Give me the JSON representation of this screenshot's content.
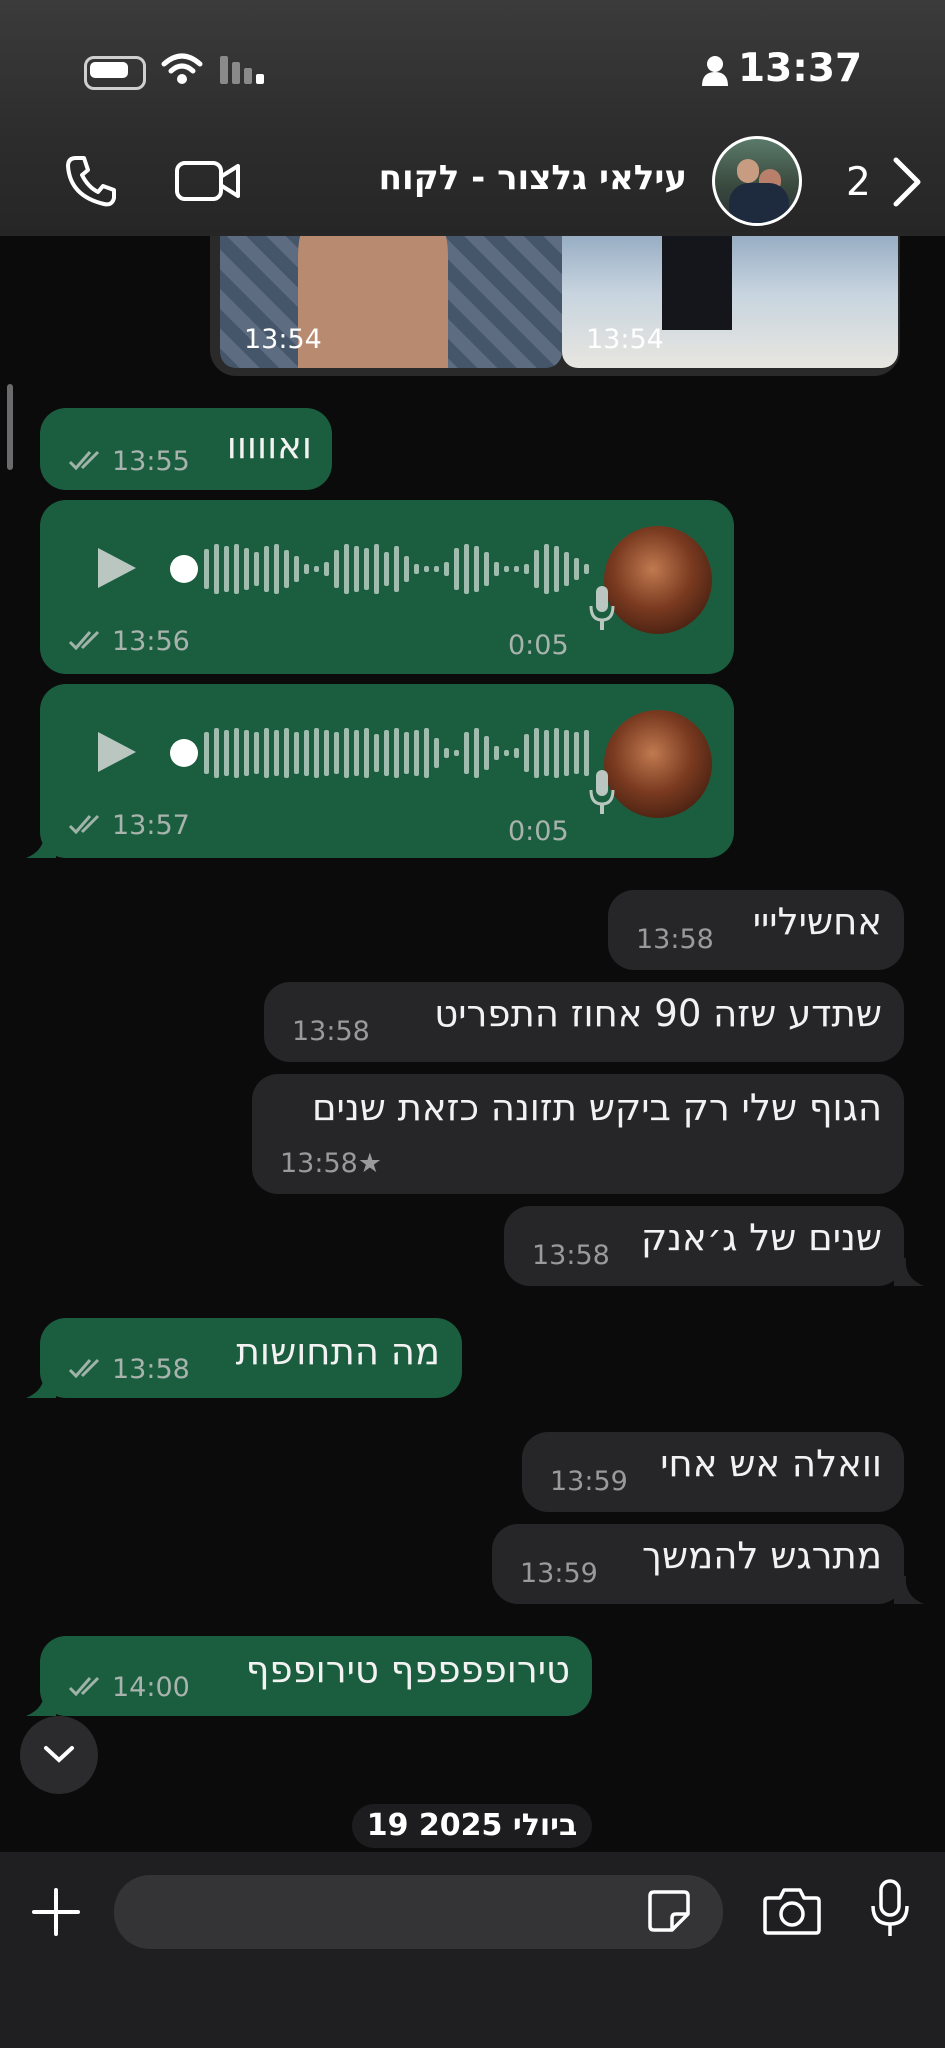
{
  "status_bar": {
    "time": "13:37"
  },
  "header": {
    "contact_name": "עילאי גלצור - לקוח",
    "back_count": "2"
  },
  "media": {
    "left_time": "13:54",
    "right_time": "13:54"
  },
  "messages": [
    {
      "dir": "out",
      "text": "ואווווו",
      "time": "13:55"
    },
    {
      "dir": "out",
      "type": "voice",
      "duration": "0:05",
      "time": "13:56"
    },
    {
      "dir": "out",
      "type": "voice",
      "duration": "0:05",
      "time": "13:57"
    },
    {
      "dir": "in",
      "text": "אחשילייי",
      "time": "13:58"
    },
    {
      "dir": "in",
      "text": "שתדע שזה 90 אחוז התפריט",
      "time": "13:58"
    },
    {
      "dir": "in",
      "text": "הגוף שלי רק ביקש תזונה כזאת שנים",
      "time": "13:58★"
    },
    {
      "dir": "in",
      "text": "שנים של ג׳אנק",
      "time": "13:58"
    },
    {
      "dir": "out",
      "text": "מה התחושות",
      "time": "13:58"
    },
    {
      "dir": "in",
      "text": "וואלה אש אחי",
      "time": "13:59"
    },
    {
      "dir": "in",
      "text": "מתרגש להמשך",
      "time": "13:59"
    },
    {
      "dir": "out",
      "text": "טירופפפפף טירופפף",
      "time": "14:00"
    }
  ],
  "date_divider": "19 ביולי 2025",
  "input": {
    "placeholder": ""
  },
  "colors": {
    "outgoing": "#1b5e3f",
    "incoming": "#262628",
    "background": "#0b0b0c"
  }
}
